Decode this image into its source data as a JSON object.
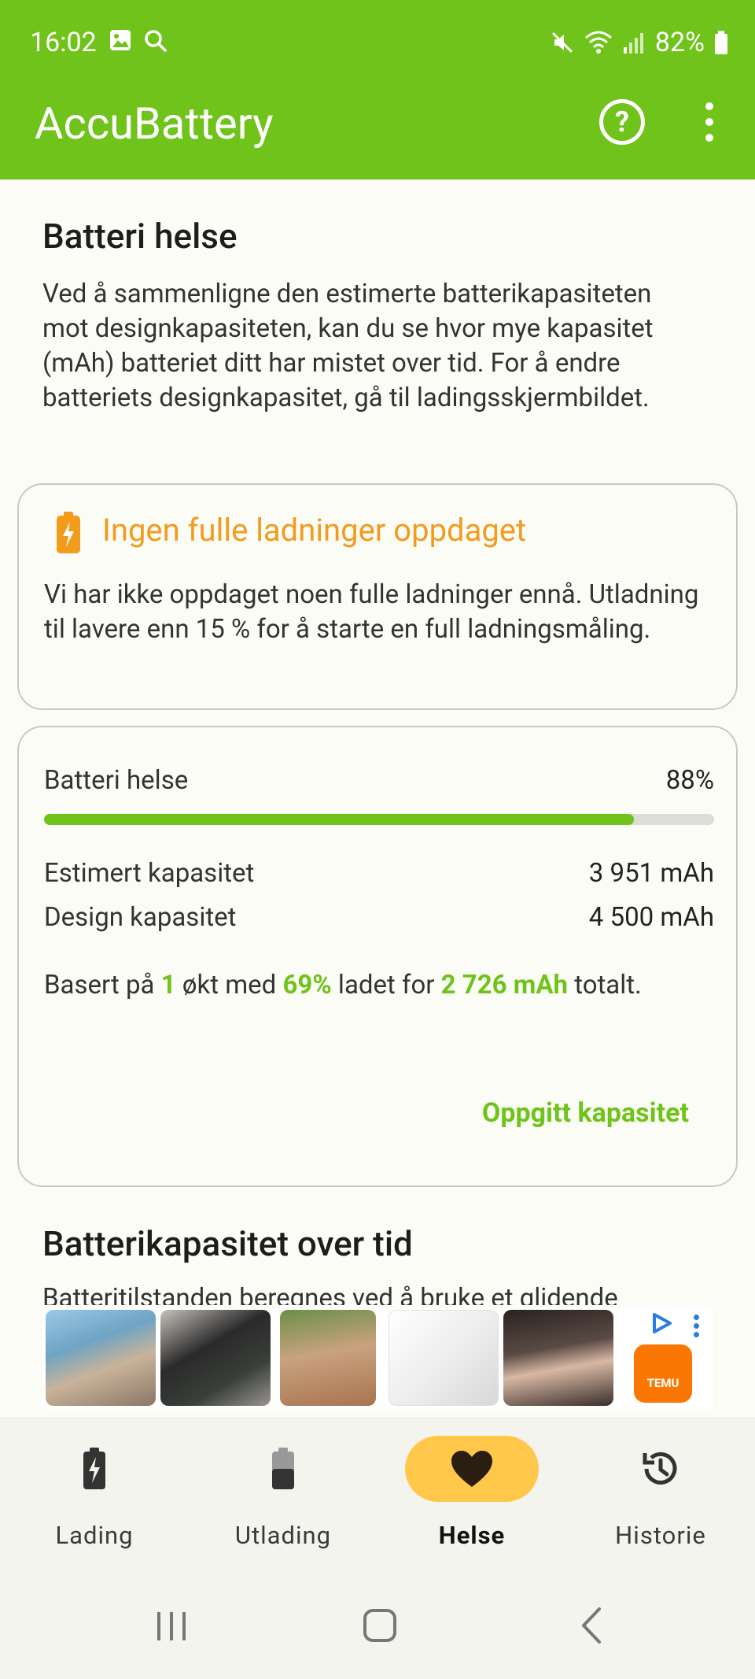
{
  "status_bar": {
    "time": "16:02",
    "battery": "82%"
  },
  "app_bar": {
    "title": "AccuBattery",
    "help_icon": "help-circle-icon",
    "more_icon": "more-vert-icon"
  },
  "section_health": {
    "title": "Batteri helse",
    "description": "Ved å sammenligne den estimerte batterikapasiteten mot designkapasiteten, kan du se hvor mye kapasitet (mAh) batteriet ditt har mistet over tid. For å endre batteriets designkapasitet, gå til ladingsskjermbildet."
  },
  "warning_card": {
    "title": "Ingen fulle ladninger oppdaget",
    "text": "Vi har ikke oppdaget noen fulle ladninger ennå. Utladning til lavere enn 15 % for å starte en full ladningsmåling."
  },
  "health_card": {
    "label": "Batteri helse",
    "value": "88%",
    "progress_percent": 88,
    "estimated_label": "Estimert kapasitet",
    "estimated_value": "3 951 mAh",
    "design_label": "Design kapasitet",
    "design_value": "4 500 mAh",
    "based_part1": "Basert på ",
    "based_sessions": "1",
    "based_part2": " økt med ",
    "based_percent": "69%",
    "based_part3": " ladet for ",
    "based_mah": "2 726 mAh",
    "based_part4": " totalt.",
    "button_label": "Oppgitt kapasitet"
  },
  "section_capacity": {
    "title": "Batterikapasitet over tid",
    "description": "Batteritilstanden beregnes ved å bruke et glidende"
  },
  "ad": {
    "brand": "TEMU"
  },
  "bottom_nav": [
    {
      "label": "Lading",
      "icon": "battery-charging-icon",
      "active": false
    },
    {
      "label": "Utlading",
      "icon": "battery-half-icon",
      "active": false
    },
    {
      "label": "Helse",
      "icon": "heart-icon",
      "active": true
    },
    {
      "label": "Historie",
      "icon": "history-icon",
      "active": false
    }
  ],
  "colors": {
    "accent": "#6fc31a",
    "warning": "#f29b1c",
    "active_nav": "#ffc84a"
  }
}
